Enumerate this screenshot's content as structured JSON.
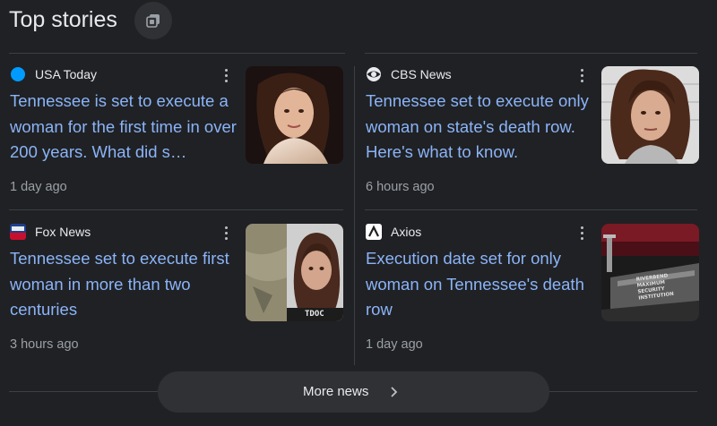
{
  "header": {
    "title": "Top stories",
    "header_icon": "collections-icon"
  },
  "stories": [
    {
      "source": "USA Today",
      "favicon": "usa-today-logo-icon",
      "headline": "Tennessee is set to execute a woman for the first time in over 200 years. What did s…",
      "time": "1 day ago"
    },
    {
      "source": "CBS News",
      "favicon": "cbs-eye-logo-icon",
      "headline": "Tennessee set to execute only woman on state's death row. Here's what to know.",
      "time": "6 hours ago"
    },
    {
      "source": "Fox News",
      "favicon": "fox-news-logo-icon",
      "headline": "Tennessee set to execute first woman in more than two centuries",
      "time": "3 hours ago",
      "thumb_caption": "TDOC"
    },
    {
      "source": "Axios",
      "favicon": "axios-logo-icon",
      "headline": "Execution date set for only woman on Tennessee's death row",
      "time": "1 day ago",
      "thumb_caption": "RIVERBEND MAXIMUM SECURITY INSTITUTION"
    }
  ],
  "more": {
    "label": "More news",
    "icon": "chevron-right-icon"
  },
  "colors": {
    "background": "#202124",
    "link": "#8ab4f8",
    "muted": "#9aa0a6",
    "text": "#e8eaed"
  }
}
